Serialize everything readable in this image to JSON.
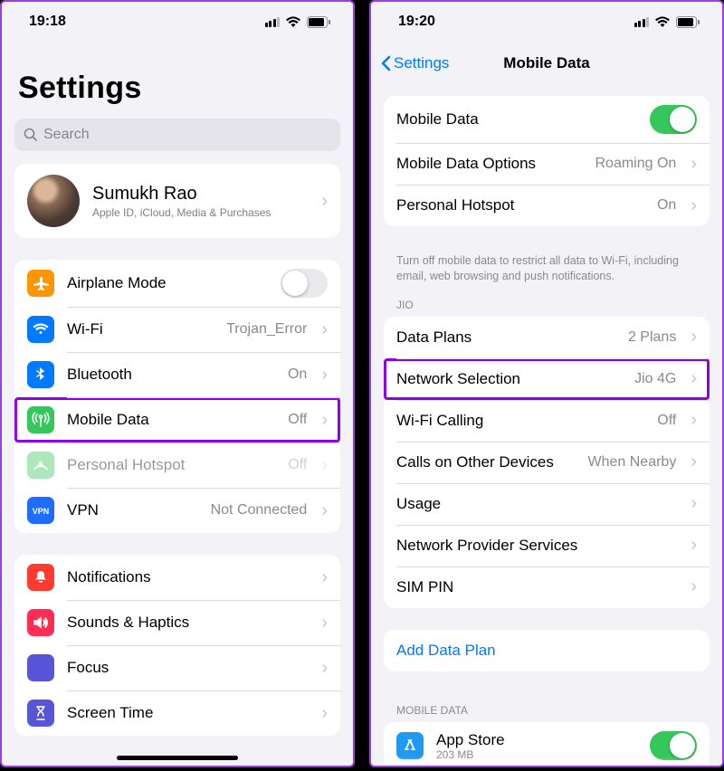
{
  "left": {
    "status": {
      "time": "19:18"
    },
    "title": "Settings",
    "search_placeholder": "Search",
    "profile": {
      "name": "Sumukh Rao",
      "subtitle": "Apple ID, iCloud, Media & Purchases"
    },
    "groups": [
      [
        {
          "icon": "airplane",
          "color": "#ff9500",
          "label": "Airplane Mode",
          "toggle": false
        },
        {
          "icon": "wifi",
          "color": "#007aff",
          "label": "Wi-Fi",
          "value": "Trojan_Error"
        },
        {
          "icon": "bluetooth",
          "color": "#007aff",
          "label": "Bluetooth",
          "value": "On"
        },
        {
          "icon": "antenna",
          "color": "#34c759",
          "label": "Mobile Data",
          "value": "Off",
          "highlight": true
        },
        {
          "icon": "hotspot",
          "color": "#34c759",
          "label": "Personal Hotspot",
          "value": "Off",
          "muted": true
        },
        {
          "icon": "vpn",
          "color": "#1f6dff",
          "label": "VPN",
          "value": "Not Connected"
        }
      ],
      [
        {
          "icon": "bell",
          "color": "#ff3b30",
          "label": "Notifications"
        },
        {
          "icon": "speaker",
          "color": "#ff2d55",
          "label": "Sounds & Haptics"
        },
        {
          "icon": "moon",
          "color": "#5856d6",
          "label": "Focus"
        },
        {
          "icon": "hourglass",
          "color": "#5856d6",
          "label": "Screen Time"
        }
      ]
    ]
  },
  "right": {
    "status": {
      "time": "19:20"
    },
    "back_label": "Settings",
    "title": "Mobile Data",
    "top_rows": [
      {
        "label": "Mobile Data",
        "toggle": true
      },
      {
        "label": "Mobile Data Options",
        "value": "Roaming On"
      },
      {
        "label": "Personal Hotspot",
        "value": "On"
      }
    ],
    "footnote": "Turn off mobile data to restrict all data to Wi-Fi, including email, web browsing and push notifications.",
    "section_jio": "JIO",
    "jio_rows": [
      {
        "label": "Data Plans",
        "value": "2 Plans"
      },
      {
        "label": "Network Selection",
        "value": "Jio 4G",
        "highlight": true
      },
      {
        "label": "Wi-Fi Calling",
        "value": "Off"
      },
      {
        "label": "Calls on Other Devices",
        "value": "When Nearby"
      },
      {
        "label": "Usage"
      },
      {
        "label": "Network Provider Services"
      },
      {
        "label": "SIM PIN"
      }
    ],
    "add_plan": "Add Data Plan",
    "section_md": "MOBILE DATA",
    "app_row": {
      "label": "App Store",
      "sub": "203 MB",
      "toggle": true,
      "icon": "appstore",
      "color": "#1e9af1"
    }
  }
}
